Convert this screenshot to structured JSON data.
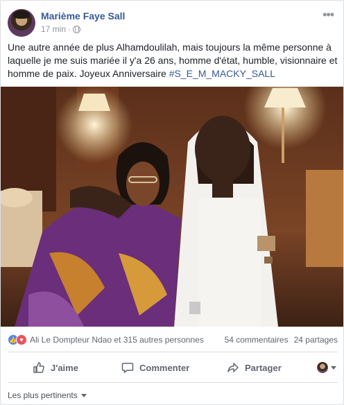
{
  "post": {
    "author": "Marième Faye Sall",
    "time": "17 min",
    "meta_separator": "·",
    "more": "•••",
    "text_main": "Une autre année de plus Alhamdoulilah, mais toujours la même personne à laquelle je me suis mariée il y'a 26 ans, homme d'état, humble, visionnaire et homme de paix. Joyeux Anniversaire ",
    "hashtag": "#S_E_M_MACKY_SALL"
  },
  "reactions": {
    "like_icon": "👍",
    "love_icon": "♥",
    "reactors": "Ali Le Dompteur Ndao et 315 autres personnes",
    "comments": "54 commentaires",
    "shares": "24 partages"
  },
  "actions": {
    "like": "J'aime",
    "comment": "Commenter",
    "share": "Partager"
  },
  "sort": {
    "label": "Les plus pertinents"
  },
  "colors": {
    "link": "#365899",
    "like": "#4f86f7",
    "love": "#f0515c",
    "muted": "#606770"
  }
}
